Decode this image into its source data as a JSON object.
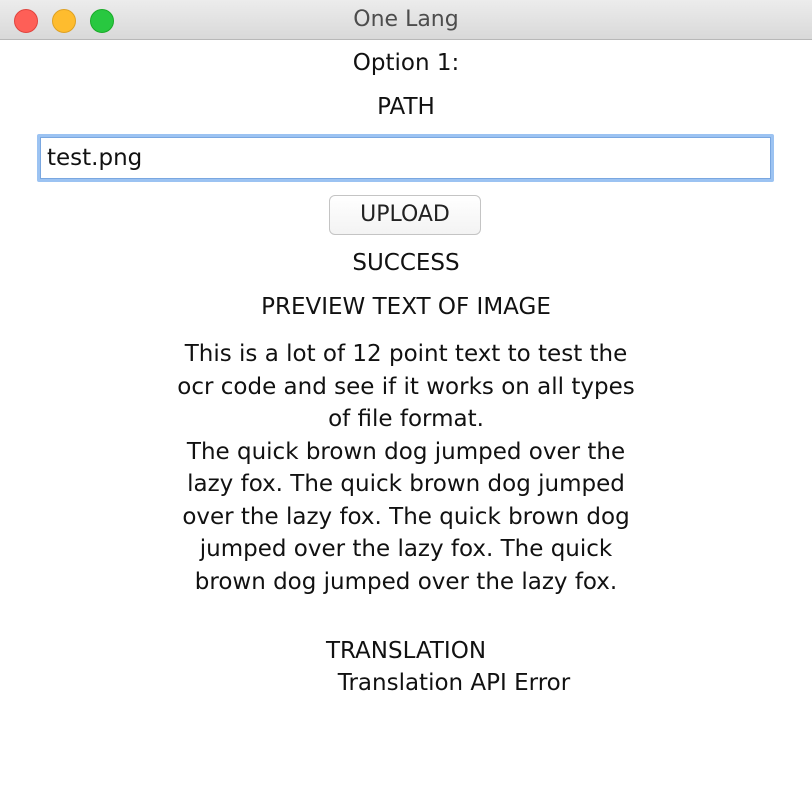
{
  "window": {
    "title": "One Lang"
  },
  "main": {
    "option_label": "Option 1:",
    "path_label": "PATH",
    "path_input": {
      "value": "test.png",
      "placeholder": ""
    },
    "upload_button_label": "UPLOAD",
    "status_text": "SUCCESS",
    "preview_heading": "PREVIEW TEXT OF IMAGE",
    "preview_lines": [
      "This is a lot of 12 point text to test the",
      "ocr code and see if it works on all types",
      "of file format.",
      "The quick brown dog jumped over the",
      "lazy fox. The quick brown dog jumped",
      "over the lazy fox. The quick brown dog",
      "jumped over the lazy fox. The quick",
      "brown dog jumped over the lazy fox."
    ],
    "translation_heading": "TRANSLATION",
    "translation_result": "Translation API Error"
  },
  "colors": {
    "close": "#fe5f57",
    "minimize": "#febc2e",
    "zoom": "#28c840",
    "focus_ring": "#9cc3f2"
  }
}
